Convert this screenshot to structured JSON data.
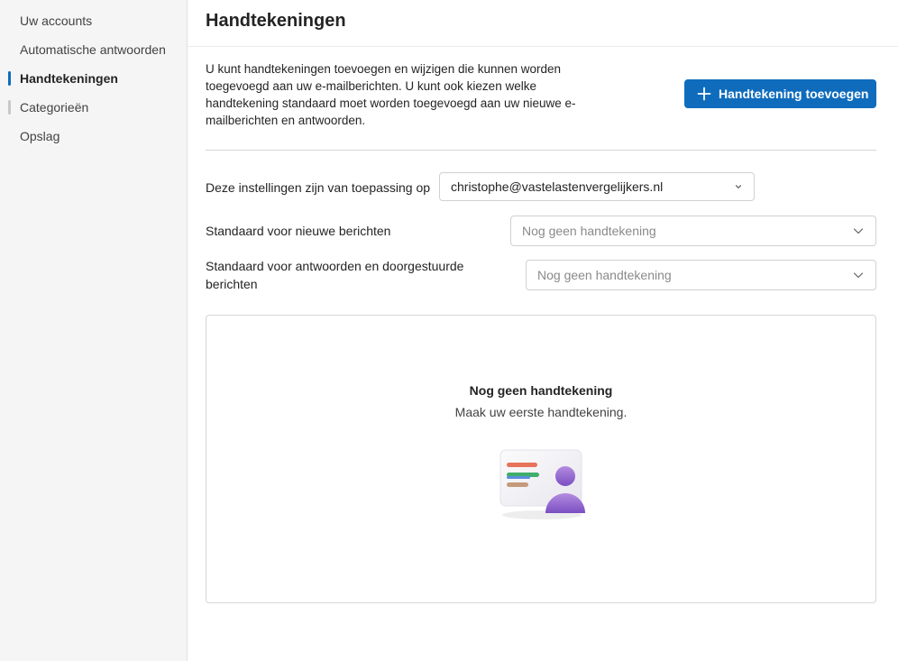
{
  "sidebar": {
    "items": [
      {
        "label": "Uw accounts"
      },
      {
        "label": "Automatische antwoorden"
      },
      {
        "label": "Handtekeningen"
      },
      {
        "label": "Categorieën"
      },
      {
        "label": "Opslag"
      }
    ]
  },
  "main": {
    "title": "Handtekeningen",
    "description": "U kunt handtekeningen toevoegen en wijzigen die kunnen worden toegevoegd aan uw e-mailberichten. U kunt ook kiezen welke handtekening standaard moet worden toegevoegd aan uw nieuwe e-mailberichten en antwoorden.",
    "add_button_label": "Handtekening toevoegen",
    "apply_to": {
      "label": "Deze instellingen zijn van toepassing op",
      "value": "christophe@vastelastenvergelijkers.nl"
    },
    "new_messages": {
      "label": "Standaard voor nieuwe berichten",
      "value": "Nog geen handtekening"
    },
    "replies": {
      "label": "Standaard voor antwoorden en doorgestuurde berichten",
      "value": "Nog geen handtekening"
    },
    "empty_state": {
      "title": "Nog geen handtekening",
      "subtitle": "Maak uw eerste handtekening."
    }
  },
  "colors": {
    "accent": "#0f6cbd",
    "sidebar_bg": "#f5f5f5"
  }
}
